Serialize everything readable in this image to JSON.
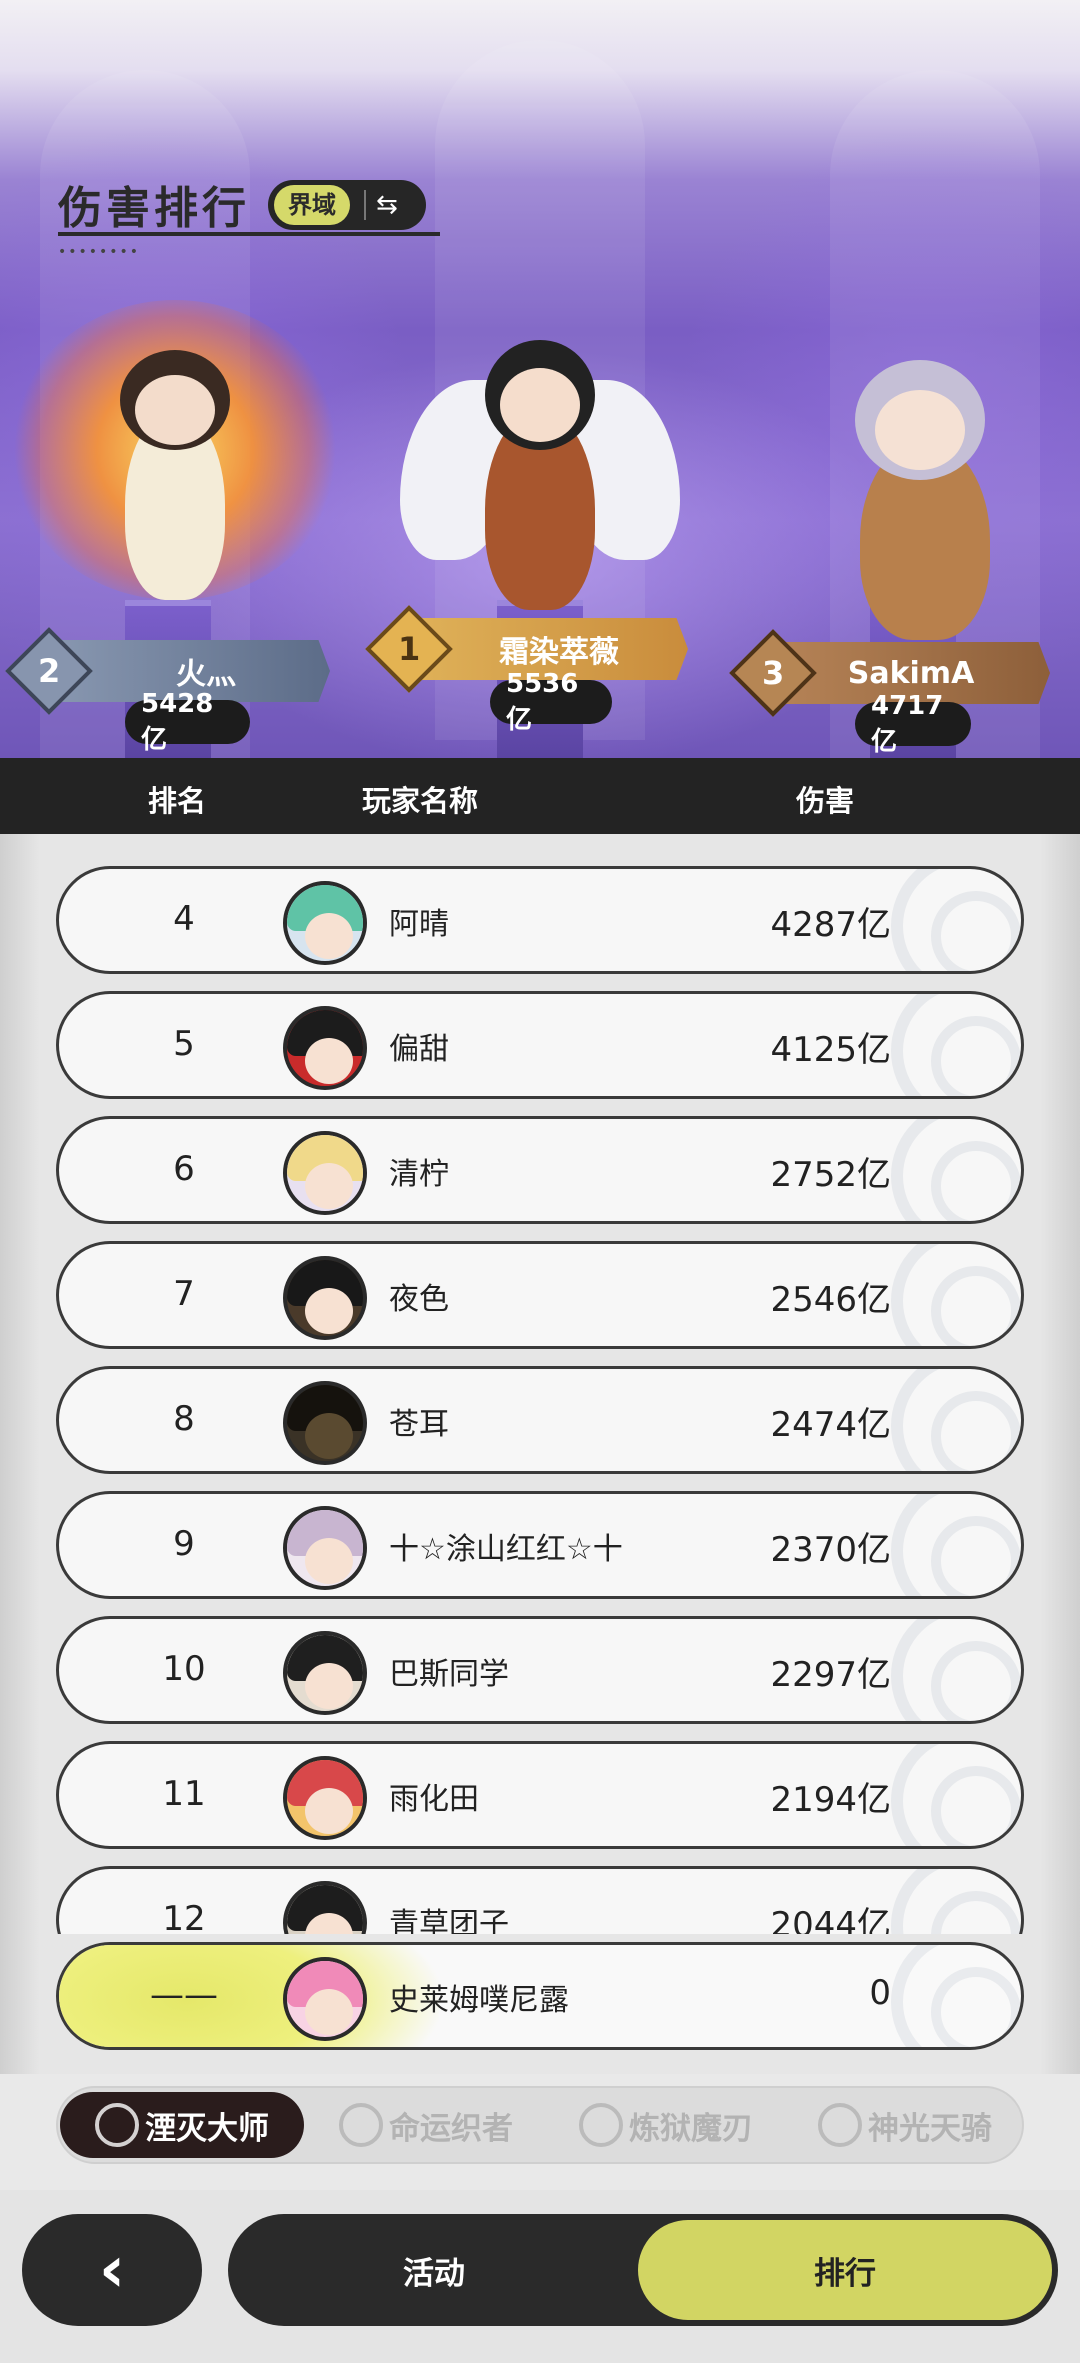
{
  "header": {
    "title": "伤害排行",
    "realm_label": "界域",
    "swap_icon": "swap-arrows-icon"
  },
  "podium": {
    "first": {
      "rank": "1",
      "name": "霜染萃薇",
      "score": "5536亿"
    },
    "second": {
      "rank": "2",
      "name": "火灬",
      "score": "5428亿"
    },
    "third": {
      "rank": "3",
      "name": "SakimA",
      "score": "4717亿"
    }
  },
  "table_header": {
    "rank": "排名",
    "player_name": "玩家名称",
    "damage": "伤害"
  },
  "rows": [
    {
      "rank": "4",
      "name": "阿晴",
      "damage": "4287亿"
    },
    {
      "rank": "5",
      "name": "偏甜",
      "damage": "4125亿"
    },
    {
      "rank": "6",
      "name": "清柠",
      "damage": "2752亿"
    },
    {
      "rank": "7",
      "name": "夜色",
      "damage": "2546亿"
    },
    {
      "rank": "8",
      "name": "苍耳",
      "damage": "2474亿"
    },
    {
      "rank": "9",
      "name": "十☆涂山红红☆十",
      "damage": "2370亿"
    },
    {
      "rank": "10",
      "name": "巴斯同学",
      "damage": "2297亿"
    },
    {
      "rank": "11",
      "name": "雨化田",
      "damage": "2194亿"
    },
    {
      "rank": "12",
      "name": "青草团子",
      "damage": "2044亿"
    }
  ],
  "self_row": {
    "rank": "——",
    "name": "史莱姆噗尼露",
    "damage": "0"
  },
  "class_tabs": [
    {
      "label": "湮灭大师",
      "active": true
    },
    {
      "label": "命运织者",
      "active": false
    },
    {
      "label": "炼狱魔刃",
      "active": false
    },
    {
      "label": "神光天骑",
      "active": false
    }
  ],
  "bottom_nav": {
    "back_icon": "chevron-left-icon",
    "activity": "活动",
    "ranking": "排行"
  },
  "colors": {
    "accent": "#d2d563",
    "dark": "#2a2a2a",
    "gold": "#d9a84a",
    "silver": "#7f8fa8",
    "bronze": "#a9784a"
  }
}
